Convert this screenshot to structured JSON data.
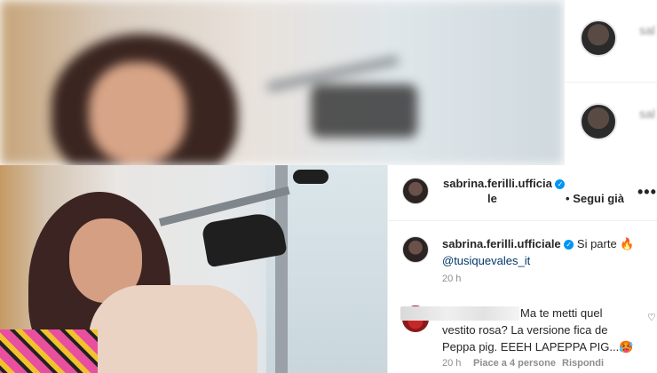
{
  "post": {
    "header_username_line1": "sabrina.ferilli.ufficia",
    "header_username_line2": "le",
    "verified_glyph": "✓",
    "bullet": "•",
    "follow_label": "Segui già",
    "more_label": "•••"
  },
  "caption": {
    "username": "sabrina.ferilli.ufficiale",
    "text": "Si parte 🔥",
    "mention": "@tusiquevales_it",
    "time": "20 h"
  },
  "comment": {
    "line1": "Ma te metti quel",
    "line2": "vestito rosa? La versione fica de",
    "line3": "Peppa pig. EEEH LAPEPPA PIG...🥵",
    "time": "20 h",
    "likes": "Piace a 4 persone",
    "reply_label": "Rispondi",
    "heart_glyph": "♡"
  },
  "colors": {
    "verified": "#0095f6",
    "text": "#262626",
    "meta": "#8e8e8e",
    "link": "#00376b"
  },
  "icons": [
    "verified-badge-icon",
    "more-options-icon",
    "heart-icon",
    "fire-emoji",
    "hot-face-emoji"
  ]
}
